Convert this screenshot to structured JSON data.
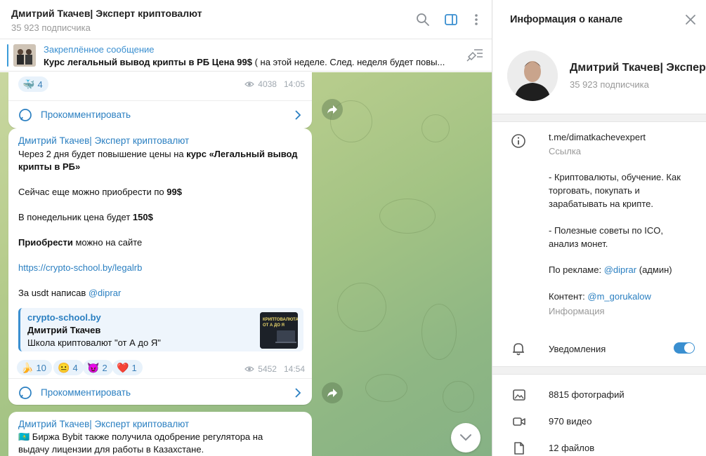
{
  "chat": {
    "title": "Дмитрий Ткачев| Эксперт криптовалют",
    "subscribers": "35 923 подписчика"
  },
  "pinned": {
    "label": "Закреплённое сообщение",
    "text_bold": "Курс легальный вывод крипты в РБ   Цена 99$",
    "text_rest": "  ( на этой неделе. След. неделя будет повы..."
  },
  "messages": [
    {
      "reaction": {
        "emoji": "🐳",
        "count": "4"
      },
      "views": "4038",
      "time": "14:05",
      "comment_label": "Прокомментировать"
    },
    {
      "author": "Дмитрий Ткачев| Эксперт криптовалют",
      "line1_pre": "Через 2 дня будет повышение цены на ",
      "line1_bold": "курс «Легальный вывод",
      "line2_bold": "крипты в РБ»",
      "line3_pre": "Сейчас еще можно приобрести по ",
      "line3_bold": "99$",
      "line4_pre": "В понедельник цена будет ",
      "line4_bold": "150$",
      "line5_bold": "Приобрести",
      "line5_rest": " можно на сайте",
      "link": "https://crypto-school.by/legalrb",
      "line7_pre": "За usdt написав ",
      "line7_mention": "@diprar",
      "preview": {
        "site": "crypto-school.by",
        "title": "Дмитрий Ткачев",
        "desc": "Школа криптовалют \"от А до Я\"",
        "img_text": "КРИПТОВАЛЮТА\nОТ А ДО Я"
      },
      "reactions": [
        {
          "emoji": "🍌",
          "count": "10"
        },
        {
          "emoji": "😐",
          "count": "4"
        },
        {
          "emoji": "😈",
          "count": "2"
        },
        {
          "emoji": "❤️",
          "count": "1"
        }
      ],
      "views": "5452",
      "time": "14:54",
      "comment_label": "Прокомментировать"
    },
    {
      "author": "Дмитрий Ткачев| Эксперт криптовалют",
      "line1": "🇰🇿 Биржа Bybit также получила одобрение регулятора на",
      "line2": "выдачу лицензии для работы в Казахстане."
    }
  ],
  "panel": {
    "title": "Информация о канале",
    "name": "Дмитрий Ткачев| Эксперт криптовалют",
    "subscribers": "35 923 подписчика",
    "link": "t.me/dimatkachevexpert",
    "link_label": "Ссылка",
    "desc1": "- Криптовалюты, обучение. Как",
    "desc2": "торговать, покупать и",
    "desc3": "зарабатывать на крипте.",
    "desc4": "- Полезные советы по ICO,",
    "desc5": "анализ монет.",
    "ads_pre": "По рекламе: ",
    "ads_mention": "@diprar",
    "ads_post": " (админ)",
    "content_pre": "Контент: ",
    "content_mention": "@m_gorukalow",
    "info_label": "Информация",
    "notifications": "Уведомления",
    "notifications_on": true,
    "media": [
      {
        "label": "8815 фотографий",
        "icon": "photo-icon"
      },
      {
        "label": "970 видео",
        "icon": "video-icon"
      },
      {
        "label": "12 файлов",
        "icon": "file-icon"
      }
    ]
  }
}
